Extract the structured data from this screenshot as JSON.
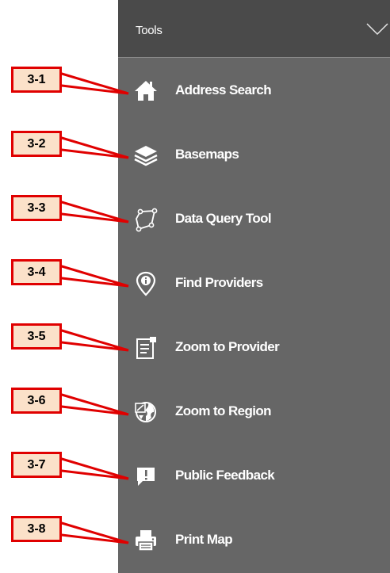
{
  "panel": {
    "title": "Tools",
    "collapse_icon": "chevron-down-icon"
  },
  "tools": [
    {
      "label": "Address Search",
      "icon": "home-icon"
    },
    {
      "label": "Basemaps",
      "icon": "layers-icon"
    },
    {
      "label": "Data Query Tool",
      "icon": "polygon-select-icon"
    },
    {
      "label": "Find Providers",
      "icon": "info-pin-icon"
    },
    {
      "label": "Zoom to Provider",
      "icon": "document-list-icon"
    },
    {
      "label": "Zoom to Region",
      "icon": "globe-map-icon"
    },
    {
      "label": "Public Feedback",
      "icon": "feedback-icon"
    },
    {
      "label": "Print Map",
      "icon": "printer-icon"
    }
  ],
  "callouts": [
    "3-1",
    "3-2",
    "3-3",
    "3-4",
    "3-5",
    "3-6",
    "3-7",
    "3-8"
  ],
  "colors": {
    "panel_bg": "#666666",
    "header_bg": "#4a4a4a",
    "callout_fill": "#fbe1c9",
    "callout_border": "#e00000",
    "text": "#ffffff"
  }
}
